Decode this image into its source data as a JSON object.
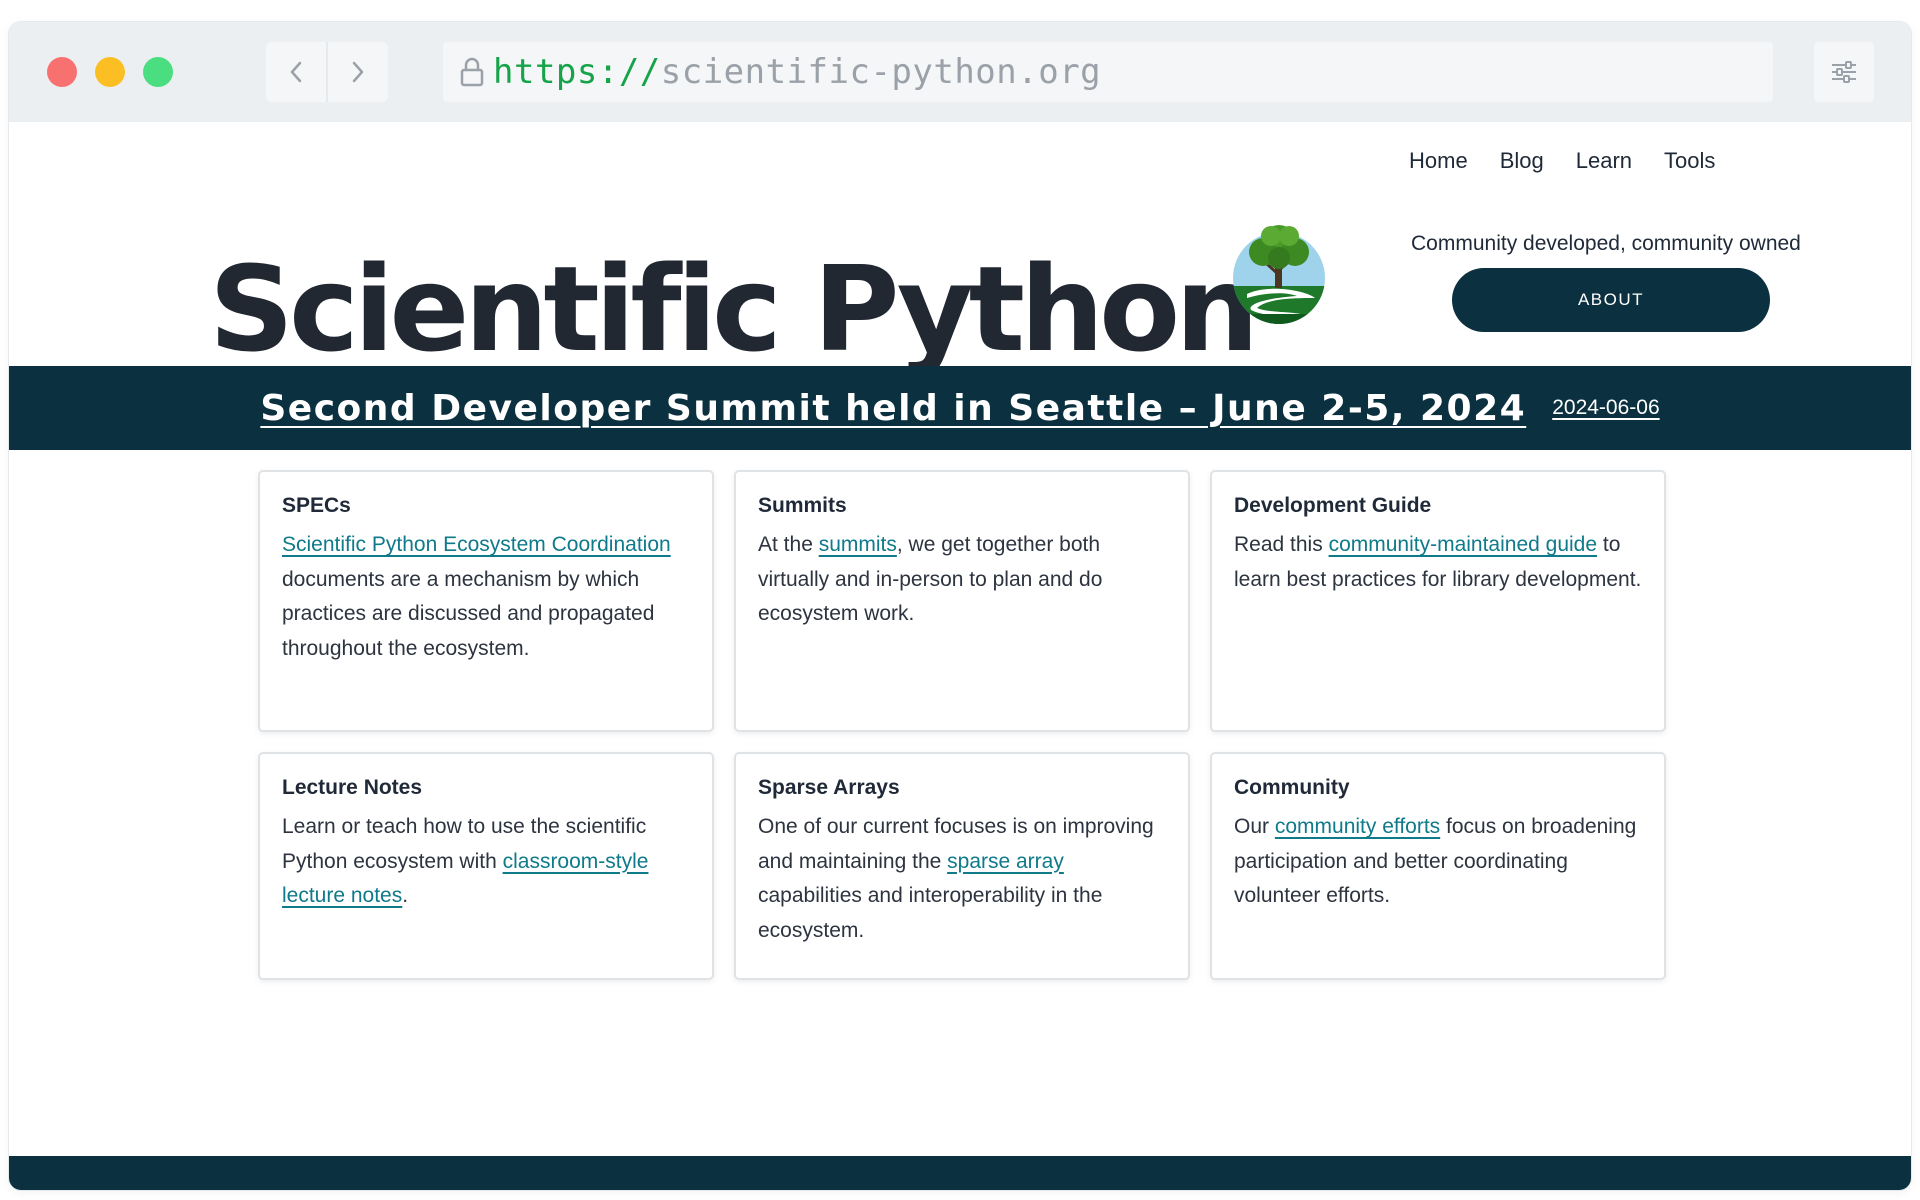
{
  "browser": {
    "url_scheme": "https://",
    "url_host": "scientific-python.org"
  },
  "nav": {
    "items": [
      {
        "label": "Home"
      },
      {
        "label": "Blog"
      },
      {
        "label": "Learn"
      },
      {
        "label": "Tools"
      }
    ]
  },
  "hero": {
    "title": "Scientific Python",
    "tagline": "Community developed, community owned",
    "about_button": "ABOUT"
  },
  "banner": {
    "headline": "Second Developer Summit held in Seattle – June 2-5, 2024",
    "date": "2024-06-06"
  },
  "cards": [
    {
      "title": "SPECs",
      "before": "",
      "link": "Scientific Python Ecosystem Coordination",
      "after": " documents are a mechanism by which practices are discussed and propagated throughout the ecosystem."
    },
    {
      "title": "Summits",
      "before": "At the ",
      "link": "summits",
      "after": ", we get together both virtually and in-person to plan and do ecosystem work."
    },
    {
      "title": "Development Guide",
      "before": "Read this ",
      "link": "community-maintained guide",
      "after": " to learn best practices for library development."
    },
    {
      "title": "Lecture Notes",
      "before": "Learn or teach how to use the scientific Python ecosystem with ",
      "link": "classroom-style lecture notes",
      "after": "."
    },
    {
      "title": "Sparse Arrays",
      "before": "One of our current focuses is on improving and maintaining the ",
      "link": "sparse array",
      "after": " capabilities and interoperability in the ecosystem."
    },
    {
      "title": "Community",
      "before": "Our ",
      "link": "community efforts",
      "after": " focus on broadening participation and better coordinating volunteer efforts."
    }
  ],
  "colors": {
    "primary_dark": "#0b3140",
    "link": "#0f7a8a",
    "url_scheme": "#16a34a"
  }
}
